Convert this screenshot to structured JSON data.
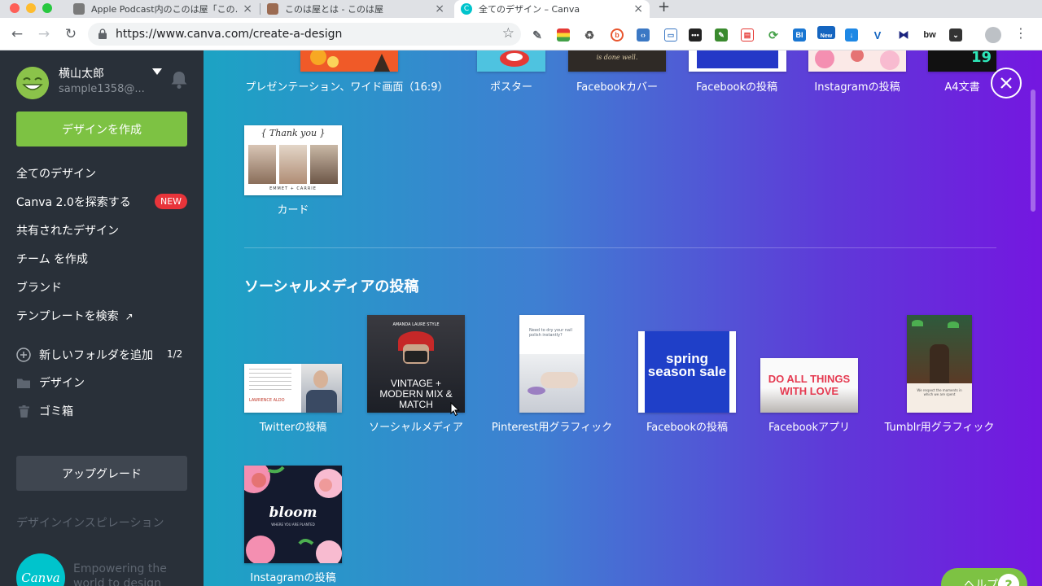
{
  "browser": {
    "tabs": [
      {
        "label": "Apple Podcast内のこのは屋「この…",
        "fav_color": "#7a7a7a"
      },
      {
        "label": "このは屋とは - このは屋",
        "fav_color": "#9b6b52"
      },
      {
        "label": "全てのデザイン – Canva",
        "fav_color": "#00c4cc"
      }
    ],
    "url": "https://www.canva.com/create-a-design",
    "new_badge": "New"
  },
  "sidebar": {
    "user_name": "横山太郎",
    "user_email": "sample1358@...",
    "create_label": "デザインを作成",
    "menu": [
      {
        "label": "全てのデザイン"
      },
      {
        "label": "Canva 2.0を探索する"
      },
      {
        "label": "共有されたデザイン"
      },
      {
        "label": "チーム を作成"
      },
      {
        "label": "ブランド"
      },
      {
        "label": "テンプレートを検索"
      }
    ],
    "new_badge": "NEW",
    "add_folder_label": "新しいフォルダを追加",
    "folder_count": "1/2",
    "folders": [
      {
        "label": "デザイン"
      },
      {
        "label": "ゴミ箱"
      }
    ],
    "upgrade_label": "アップグレード",
    "inspiration_label": "デザインインスピレーション",
    "logo_text": "Canva",
    "promo_text": "Empowering the world to design"
  },
  "main": {
    "top_row": [
      {
        "label": "プレゼンテーション、ワイド画面（16:9）"
      },
      {
        "label": "ポスター"
      },
      {
        "label": "Facebookカバー",
        "thumb_text": "is done well."
      },
      {
        "label": "Facebookの投稿"
      },
      {
        "label": "Instagramの投稿"
      },
      {
        "label": "A4文書",
        "thumb_text": "19"
      }
    ],
    "card": {
      "label": "カード",
      "thumb_title": "{ Thank you }",
      "thumb_names": "EMMET + CARRIE"
    },
    "section_title": "ソーシャルメディアの投稿",
    "social": [
      {
        "label": "Twitterの投稿",
        "thumb_text": "LAWRENCE ALDO"
      },
      {
        "label": "ソーシャルメディア",
        "thumb_text": "VINTAGE + MODERN MIX & MATCH",
        "thumb_top": "AMANDA LAURE STYLE"
      },
      {
        "label": "Pinterest用グラフィック",
        "thumb_text": "Need to dry your nail polish instantly?"
      },
      {
        "label": "Facebookの投稿",
        "thumb_text": "spring season sale"
      },
      {
        "label": "Facebookアプリ",
        "thumb_text": "DO ALL THINGS WITH LOVE"
      },
      {
        "label": "Tumblr用グラフィック",
        "thumb_text": "We respect the moments in which we are spent"
      }
    ],
    "instagram": {
      "label": "Instagramの投稿",
      "thumb_text": "bloom",
      "thumb_sub": "WHERE YOU ARE PLANTED"
    },
    "help_label": "ヘルプ",
    "help_icon": "?"
  }
}
